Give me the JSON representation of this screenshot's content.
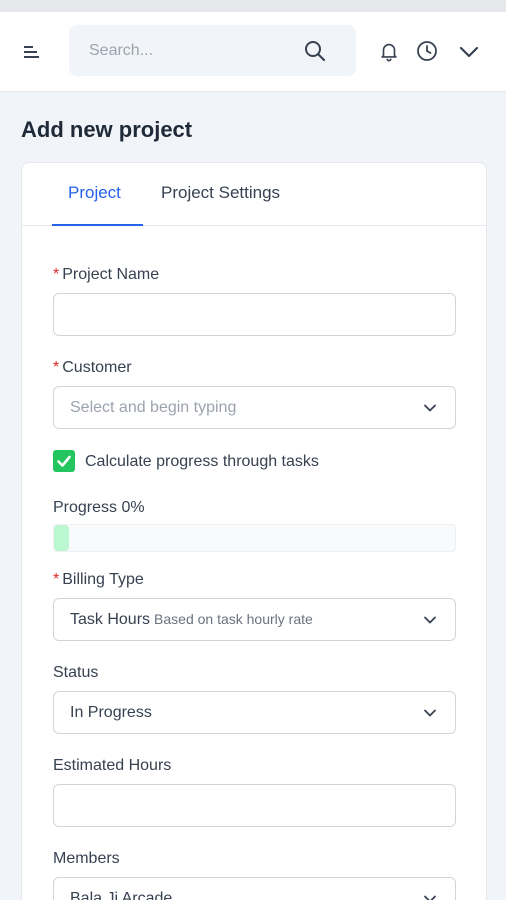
{
  "header": {
    "search_placeholder": "Search..."
  },
  "page": {
    "title": "Add new project"
  },
  "tabs": [
    {
      "label": "Project",
      "active": true
    },
    {
      "label": "Project Settings",
      "active": false
    }
  ],
  "form": {
    "project_name": {
      "label": "Project Name",
      "required": "*",
      "value": ""
    },
    "customer": {
      "label": "Customer",
      "required": "*",
      "placeholder": "Select and begin typing"
    },
    "calculate_progress": {
      "label": "Calculate progress through tasks",
      "checked": true
    },
    "progress": {
      "label": "Progress 0%",
      "value": 0
    },
    "billing_type": {
      "label": "Billing Type",
      "required": "*",
      "value": "Task Hours",
      "subtext": "Based on task hourly rate"
    },
    "status": {
      "label": "Status",
      "value": "In Progress"
    },
    "estimated_hours": {
      "label": "Estimated Hours",
      "value": ""
    },
    "members": {
      "label": "Members",
      "value": "Bala Ji Arcade"
    }
  },
  "colors": {
    "accent": "#2563eb",
    "required": "#dc2626",
    "checkbox": "#22c55e",
    "progress_fill": "#bbf7d0"
  }
}
